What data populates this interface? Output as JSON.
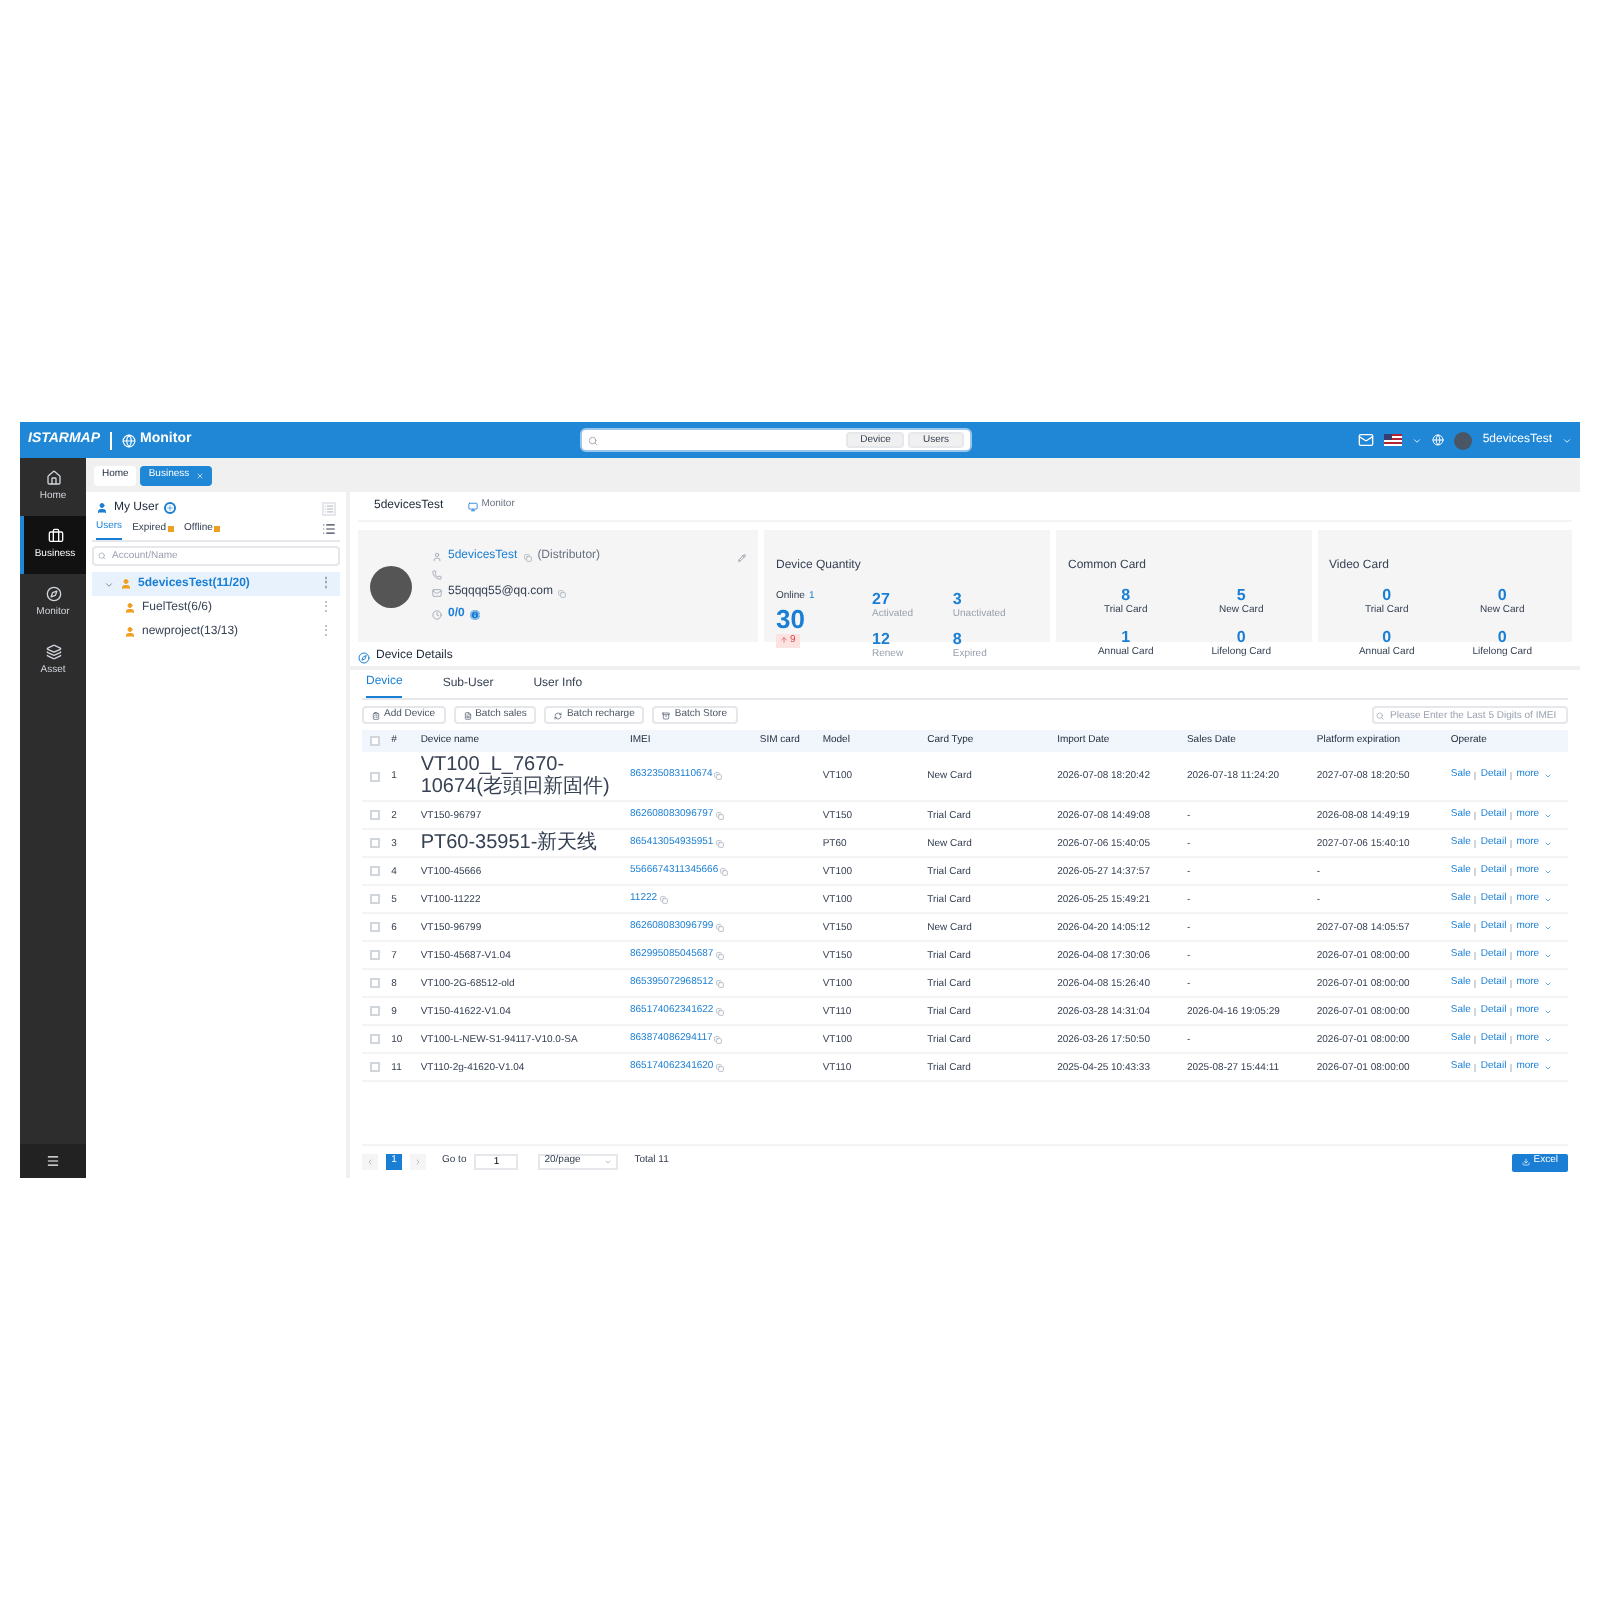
{
  "header": {
    "logo": "ISTARMAP",
    "app": "Monitor",
    "search_buttons": [
      "Device",
      "Users"
    ],
    "user": "5devicesTest"
  },
  "nav": [
    {
      "label": "Home",
      "selected": false
    },
    {
      "label": "Business",
      "selected": true
    },
    {
      "label": "Monitor",
      "selected": false
    },
    {
      "label": "Asset",
      "selected": false
    }
  ],
  "page_tabs": [
    {
      "label": "Home",
      "selected": false,
      "closable": false
    },
    {
      "label": "Business",
      "selected": true,
      "closable": true
    }
  ],
  "user_panel": {
    "title": "My User",
    "tabs": [
      {
        "label": "Users",
        "selected": true,
        "flag": false
      },
      {
        "label": "Expired",
        "selected": false,
        "flag": true
      },
      {
        "label": "Offline",
        "selected": false,
        "flag": true
      }
    ],
    "search": {
      "placeholder": "Account/Name"
    },
    "tree": [
      {
        "label": "5devicesTest(11/20)",
        "menu": "⋮",
        "selected": true,
        "expanded": true,
        "children": [
          {
            "label": "FuelTest(6/6)",
            "menu": "⋮",
            "selected": false
          },
          {
            "label": "newproject(13/13)",
            "menu": "⋮",
            "selected": false
          }
        ]
      }
    ]
  },
  "detail_tabs": [
    "5devicesTest",
    "Monitor"
  ],
  "profile": {
    "name": "5devicesTest",
    "role": "(Distributor)",
    "email": "55qqqq55@qq.com",
    "balance": "0/0"
  },
  "device_quantity": {
    "title": "Device Quantity",
    "online_label": "Online",
    "online": "1",
    "total": "30",
    "change": "9",
    "stats": [
      {
        "value": "27",
        "label": "Activated"
      },
      {
        "value": "3",
        "label": "Unactivated"
      },
      {
        "value": "12",
        "label": "Renew"
      },
      {
        "value": "8",
        "label": "Expired"
      }
    ]
  },
  "card_groups": [
    {
      "title": "Common Card",
      "stats": [
        {
          "value": "8",
          "label": "Trial Card"
        },
        {
          "value": "5",
          "label": "New Card"
        },
        {
          "value": "1",
          "label": "Annual Card"
        },
        {
          "value": "0",
          "label": "Lifelong Card"
        }
      ]
    },
    {
      "title": "Video Card",
      "stats": [
        {
          "value": "0",
          "label": "Trial Card"
        },
        {
          "value": "0",
          "label": "New Card"
        },
        {
          "value": "0",
          "label": "Annual Card"
        },
        {
          "value": "0",
          "label": "Lifelong Card"
        }
      ]
    }
  ],
  "section_title": "Device Details",
  "table_tabs": [
    {
      "label": "Device",
      "selected": true
    },
    {
      "label": "Sub-User",
      "selected": false
    },
    {
      "label": "User Info",
      "selected": false
    }
  ],
  "toolbar": [
    "Add Device",
    "Batch sales",
    "Batch recharge",
    "Batch Store"
  ],
  "imei_search": {
    "placeholder": "Please Enter the Last 5 Digits of IMEI"
  },
  "table": {
    "columns": [
      "#",
      "Device name",
      "IMEI",
      "SIM card",
      "Model",
      "Card Type",
      "Import Date",
      "Sales Date",
      "Platform expiration",
      "Operate"
    ],
    "all_checked": false,
    "row_actions": [
      {
        "actions": [
          "Sale",
          "Detail",
          "more"
        ]
      },
      {
        "actions": [
          "Sale",
          "Detail",
          "more"
        ]
      },
      {
        "actions": [
          "Sale",
          "Detail",
          "more"
        ]
      },
      {
        "actions": [
          "Sale",
          "Detail",
          "more"
        ]
      },
      {
        "actions": [
          "Sale",
          "Detail",
          "more"
        ]
      },
      {
        "actions": [
          "Sale",
          "Detail",
          "more"
        ]
      },
      {
        "actions": [
          "Sale",
          "Detail",
          "more"
        ]
      },
      {
        "actions": [
          "Sale",
          "Detail",
          "more"
        ]
      },
      {
        "actions": [
          "Sale",
          "Detail",
          "more"
        ]
      },
      {
        "actions": [
          "Sale",
          "Detail",
          "more"
        ]
      },
      {
        "actions": [
          "Sale",
          "Detail",
          "more"
        ]
      }
    ],
    "rows": [
      {
        "checked": false,
        "cells": [
          "1",
          "VT100_L_7670-10674(老頭回新固件)",
          "863235083110674",
          "",
          "VT100",
          "New Card",
          "2026-07-08 18:20:42",
          "2026-07-18 11:24:20",
          "2027-07-08 18:20:50"
        ]
      },
      {
        "checked": false,
        "cells": [
          "2",
          "VT150-96797",
          "862608083096797",
          "",
          "VT150",
          "Trial Card",
          "2026-07-08 14:49:08",
          "-",
          "2026-08-08 14:49:19"
        ]
      },
      {
        "checked": false,
        "cells": [
          "3",
          "PT60-35951-新天线",
          "865413054935951",
          "",
          "PT60",
          "New Card",
          "2026-07-06 15:40:05",
          "-",
          "2027-07-06 15:40:10"
        ]
      },
      {
        "checked": false,
        "cells": [
          "4",
          "VT100-45666",
          "5566674311345666",
          "",
          "VT100",
          "Trial Card",
          "2026-05-27 14:37:57",
          "-",
          "-"
        ]
      },
      {
        "checked": false,
        "cells": [
          "5",
          "VT100-11222",
          "11222",
          "",
          "VT100",
          "Trial Card",
          "2026-05-25 15:49:21",
          "-",
          "-"
        ]
      },
      {
        "checked": false,
        "cells": [
          "6",
          "VT150-96799",
          "862608083096799",
          "",
          "VT150",
          "New Card",
          "2026-04-20 14:05:12",
          "-",
          "2027-07-08 14:05:57"
        ]
      },
      {
        "checked": false,
        "cells": [
          "7",
          "VT150-45687-V1.04",
          "862995085045687",
          "",
          "VT150",
          "Trial Card",
          "2026-04-08 17:30:06",
          "-",
          "2026-07-01 08:00:00"
        ]
      },
      {
        "checked": false,
        "cells": [
          "8",
          "VT100-2G-68512-old",
          "865395072968512",
          "",
          "VT100",
          "Trial Card",
          "2026-04-08 15:26:40",
          "-",
          "2026-07-01 08:00:00"
        ]
      },
      {
        "checked": false,
        "cells": [
          "9",
          "VT150-41622-V1.04",
          "865174062341622",
          "",
          "VT110",
          "Trial Card",
          "2026-03-28 14:31:04",
          "2026-04-16 19:05:29",
          "2026-07-01 08:00:00"
        ]
      },
      {
        "checked": false,
        "cells": [
          "10",
          "VT100-L-NEW-S1-94117-V10.0-SA",
          "863874086294117",
          "",
          "VT100",
          "Trial Card",
          "2026-03-26 17:50:50",
          "-",
          "2026-07-01 08:00:00"
        ]
      },
      {
        "checked": false,
        "cells": [
          "11",
          "VT110-2g-41620-V1.04",
          "865174062341620",
          "",
          "VT110",
          "Trial Card",
          "2025-04-25 10:43:33",
          "2025-08-27 15:44:11",
          "2026-07-01 08:00:00"
        ]
      }
    ]
  },
  "pagination": {
    "pages": [
      {
        "label": "1",
        "selected": true
      }
    ],
    "goto_label": "Go to",
    "goto_value": "1",
    "page_size": "20/page",
    "total": "Total 11"
  },
  "export_button": "Excel"
}
